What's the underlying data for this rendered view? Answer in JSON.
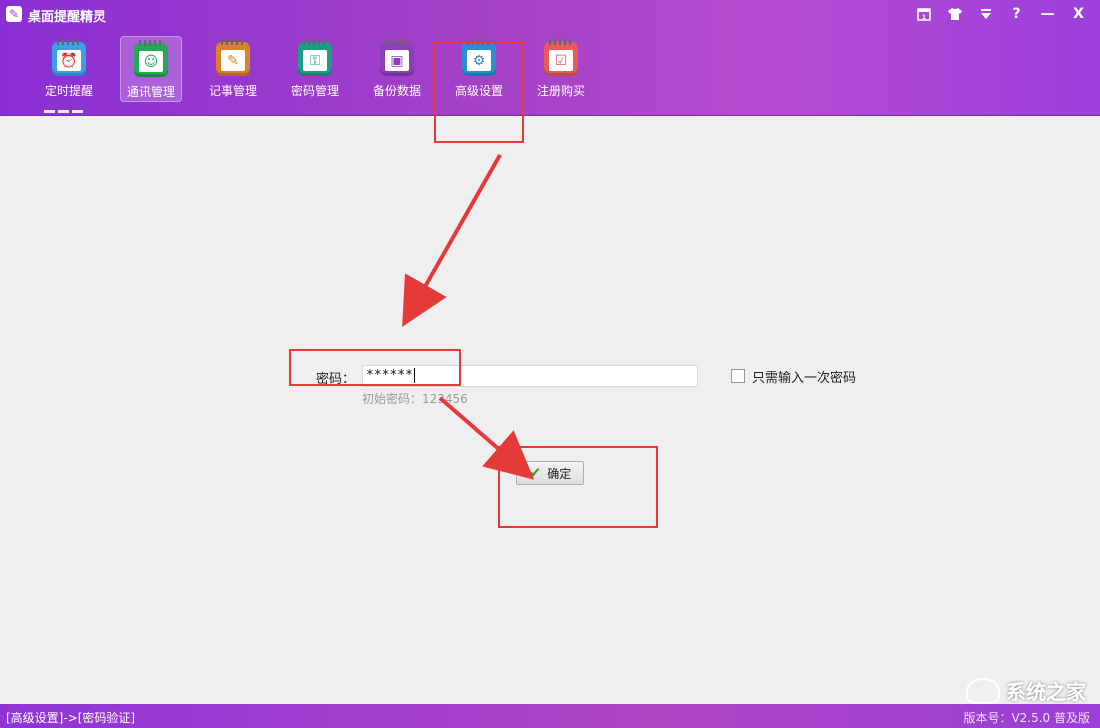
{
  "window": {
    "title": "桌面提醒精灵",
    "controls": [
      "calendar-icon",
      "skin-icon",
      "menu-icon",
      "?",
      "—",
      "X"
    ]
  },
  "toolbar": {
    "items": [
      {
        "label": "定时提醒",
        "icon": "alarm-clock-icon",
        "color": "#3aa0e8"
      },
      {
        "label": "通讯管理",
        "icon": "contacts-icon",
        "color": "#27a75a",
        "active": true
      },
      {
        "label": "记事管理",
        "icon": "notepad-icon",
        "color": "#d9822b"
      },
      {
        "label": "密码管理",
        "icon": "password-icon",
        "color": "#1e9c8a"
      },
      {
        "label": "备份数据",
        "icon": "backup-icon",
        "color": "#8c3fb8"
      },
      {
        "label": "高级设置",
        "icon": "gear-icon",
        "color": "#2a8fd0"
      },
      {
        "label": "注册购买",
        "icon": "cart-icon",
        "color": "#e85b5b"
      }
    ]
  },
  "form": {
    "password_label": "密码：",
    "password_value": "******",
    "hint": "初始密码：123456",
    "once_label": "只需输入一次密码",
    "once_checked": false,
    "confirm_label": "确定"
  },
  "status": {
    "breadcrumb": "[高级设置]->[密码验证]",
    "version": "版本号：V2.5.0 普及版"
  },
  "watermark": {
    "text": "系统之家"
  },
  "colors": {
    "annotation": "#e53a3a",
    "header": "#a542c6"
  }
}
